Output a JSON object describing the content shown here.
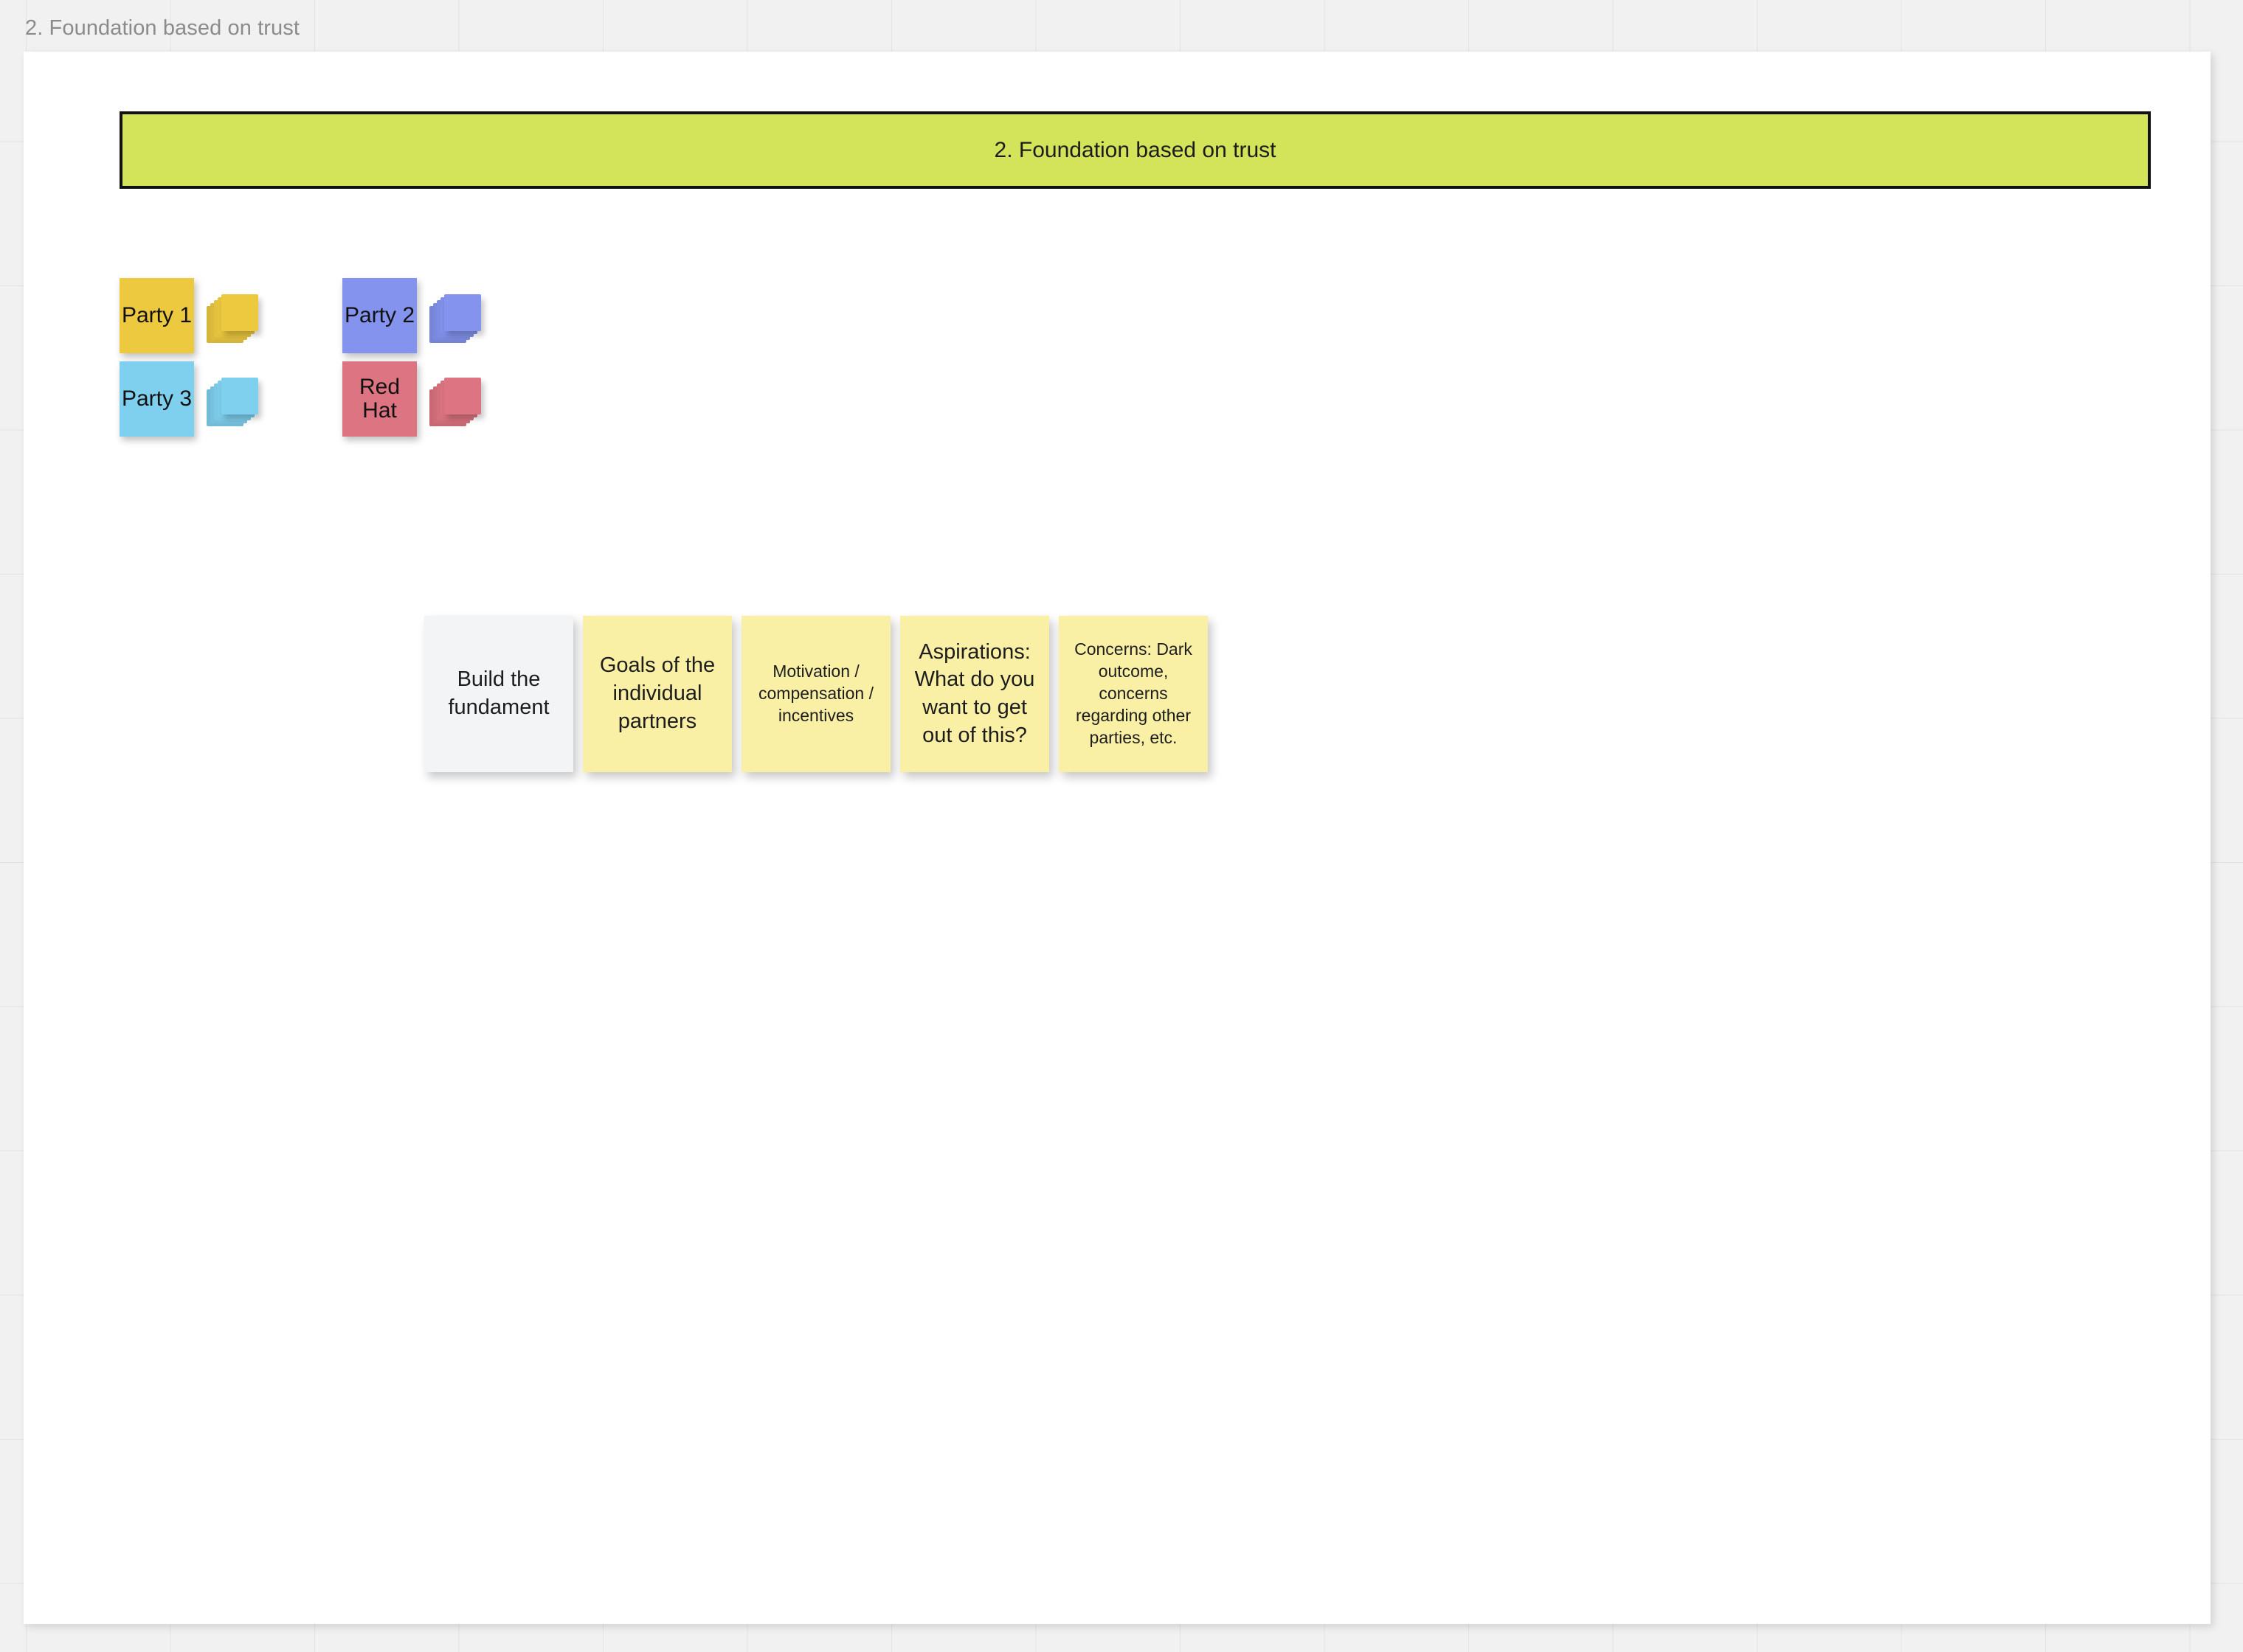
{
  "board": {
    "frame_label": "2. Foundation based on trust",
    "grid_color": "#e3e3e3",
    "canvas_bg": "#f1f1f1",
    "frame_bg": "#ffffff"
  },
  "banner": {
    "title": "2. Foundation based on trust",
    "fill": "#d3e35a",
    "border": "#111111"
  },
  "legend": {
    "columns": [
      {
        "items": [
          {
            "label": "Party 1",
            "color": "#edc940",
            "stack_icon": "sticky-stack-icon"
          },
          {
            "label": "Party 3",
            "color": "#7fd0ef",
            "stack_icon": "sticky-stack-icon"
          }
        ]
      },
      {
        "items": [
          {
            "label": "Party 2",
            "color": "#8393ee",
            "stack_icon": "sticky-stack-icon"
          },
          {
            "label": "Red Hat",
            "color": "#dd7481",
            "stack_icon": "sticky-stack-icon"
          }
        ]
      }
    ]
  },
  "notes": [
    {
      "text": "Build the fundament",
      "color": "#f3f4f6",
      "size": "lg"
    },
    {
      "text": "Goals of the individual partners",
      "color": "#faf0a5",
      "size": "lg"
    },
    {
      "text": "Motivation / compensation / incentives",
      "color": "#faf0a5",
      "size": "sm"
    },
    {
      "text": "Aspirations: What do you want to get out of this?",
      "color": "#faf0a5",
      "size": "lg"
    },
    {
      "text": "Concerns: Dark outcome, concerns regarding other parties, etc.",
      "color": "#faf0a5",
      "size": "sm"
    }
  ]
}
